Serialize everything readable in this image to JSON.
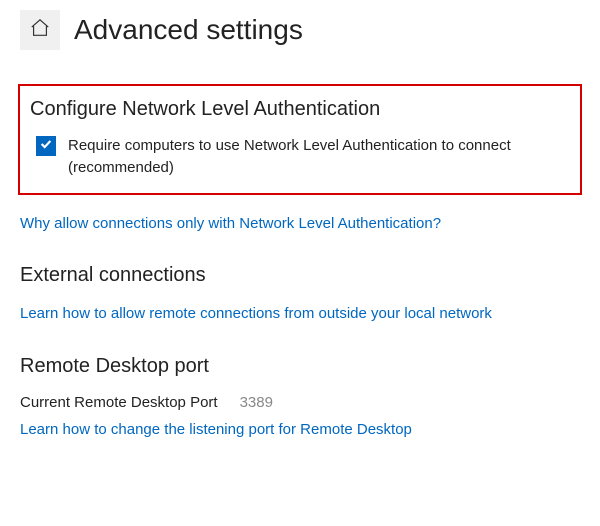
{
  "header": {
    "title": "Advanced settings"
  },
  "nla": {
    "title": "Configure Network Level Authentication",
    "checkbox_label": "Require computers to use Network Level Authentication to connect (recommended)",
    "checked": true,
    "help_link": "Why allow connections only with Network Level Authentication?"
  },
  "external": {
    "title": "External connections",
    "help_link": "Learn how to allow remote connections from outside your local network"
  },
  "rdp_port": {
    "title": "Remote Desktop port",
    "label": "Current Remote Desktop Port",
    "value": "3389",
    "help_link": "Learn how to change the listening port for Remote Desktop"
  }
}
